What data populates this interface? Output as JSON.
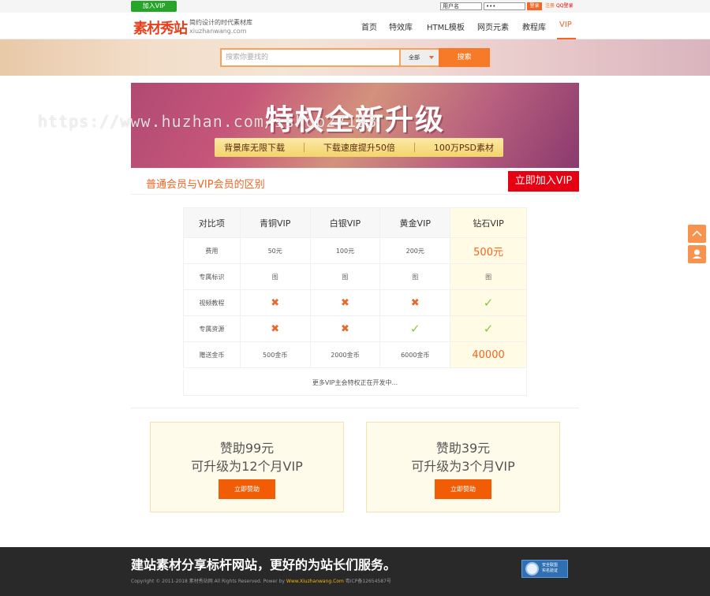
{
  "topbar": {
    "join_vip": "加入VIP",
    "username_placeholder": "用户名",
    "password_value": "•••",
    "login_btn": "登录",
    "register": "注册",
    "qq_login": "QQ登录"
  },
  "header": {
    "logo": "素材秀站",
    "tagline": "简约设计的时代素材库",
    "domain": "xiuzhanwang.com",
    "nav": [
      {
        "label": "首页"
      },
      {
        "label": "特效库"
      },
      {
        "label": "HTML模板"
      },
      {
        "label": "网页元素"
      },
      {
        "label": "教程库"
      },
      {
        "label": "VIP"
      }
    ]
  },
  "search": {
    "placeholder": "搜索你要找的",
    "select_value": "全部",
    "button": "搜索"
  },
  "promo": {
    "title": "特权全新升级",
    "features": [
      "背景库无限下载",
      "下载速度提升50倍",
      "100万PSD素材"
    ],
    "watermark": "https://www.huzhan.com/ishop27193"
  },
  "section": {
    "title": "普通会员与VIP会员的区别",
    "join_button": "立即加入VIP"
  },
  "compare": {
    "headers": [
      "对比项",
      "青铜VIP",
      "白银VIP",
      "黄金VIP",
      "钻石VIP"
    ],
    "rows": [
      {
        "label": "费用",
        "cells": [
          "50元",
          "100元",
          "200元",
          "500元"
        ]
      },
      {
        "label": "专属标识",
        "cells": [
          "图",
          "图",
          "图",
          "图"
        ]
      },
      {
        "label": "视频教程",
        "cells": [
          "✖",
          "✖",
          "✖",
          "✓"
        ]
      },
      {
        "label": "专属资源",
        "cells": [
          "✖",
          "✖",
          "✓",
          "✓"
        ]
      },
      {
        "label": "赠送金币",
        "cells": [
          "500金币",
          "2000金币",
          "6000金币",
          "40000"
        ]
      }
    ],
    "note": "更多VIP主会特权正在开发中..."
  },
  "cards": [
    {
      "line1": "赞助99元",
      "line2": "可升级为12个月VIP",
      "button": "立即赞助"
    },
    {
      "line1": "赞助39元",
      "line2": "可升级为3个月VIP",
      "button": "立即赞助"
    }
  ],
  "float": {
    "top_icon": "arrow-up-icon",
    "service_icon": "customer-service-icon"
  },
  "footer": {
    "slogan": "建站素材分享标杆网站，更好的为站长们服务。",
    "copyright_pre": "Copyright © 2011-2018 素材秀站网 All Rights Reserved. Power by",
    "copyright_link": "Www.Xiuzhanwang.Com",
    "icp": "粤ICP备12654587号",
    "badge_line1": "安全联盟",
    "badge_line2": "实名验证"
  },
  "colors": {
    "accent": "#f26522",
    "green": "#27a52b",
    "red": "#e60012"
  }
}
